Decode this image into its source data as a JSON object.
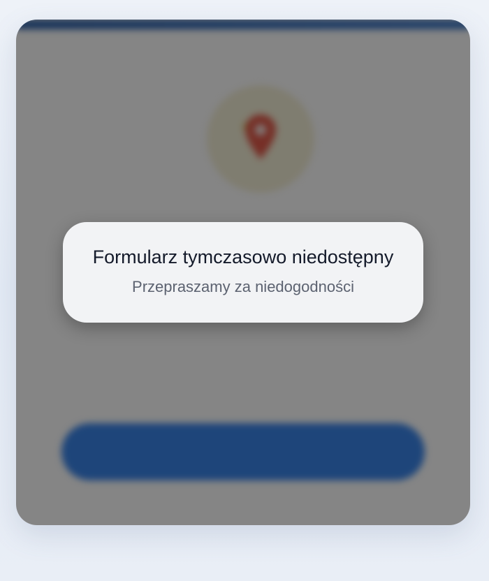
{
  "toast": {
    "title": "Formularz tymczasowo niedostępny",
    "message": "Przepraszamy za niedogodności"
  },
  "background": {
    "icon": "map-pin-icon",
    "title_obscured": "",
    "subtitle_obscured": "",
    "button_label_obscured": ""
  },
  "colors": {
    "accent": "#3a85ea",
    "header_strip": "#2b5fa8",
    "pin": "#e25a4a",
    "overlay": "rgba(0,0,0,0.48)",
    "toast_bg": "#f2f3f5"
  }
}
